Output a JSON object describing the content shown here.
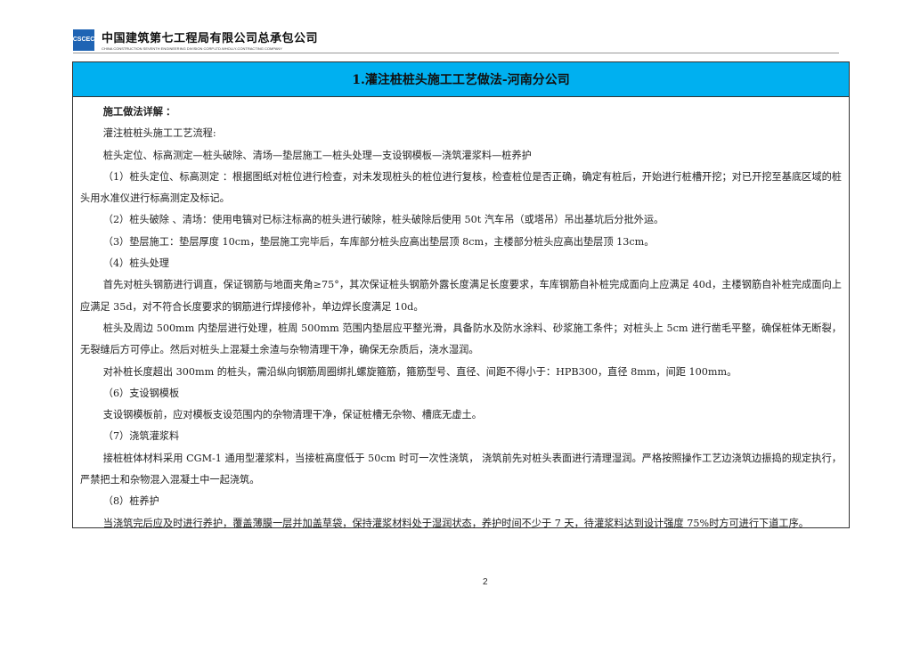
{
  "header": {
    "logo_text": "CSCEC",
    "company_cn": "中国建筑第七工程局有限公司总承包公司",
    "company_en": "CHINA CONSTRUCTION SEVENTH ENGINEERING DIVISION CORP.LTD.WHOLLY-CONTRACTING COMPANY"
  },
  "title": "1.灌注桩桩头施工工艺做法-河南分公司",
  "heading": "施工做法详解 ：",
  "paragraphs": [
    "灌注桩桩头施工工艺流程:",
    "桩头定位、标高测定—桩头破除、清场—垫层施工—桩头处理—支设钢模板—浇筑灌浆料—桩养护",
    "（1）桩头定位、标高测定 ：根据图纸对桩位进行检查，对未发现桩头的桩位进行复核，检查桩位是否正确，确定有桩后，开始进行桩槽开挖；对已开挖至基底区域的桩头用水准仪进行标高测定及标记。",
    "（2）桩头破除 、清场：使用电镐对已标注标高的桩头进行破除，桩头破除后使用 50t 汽车吊（或塔吊）吊出基坑后分批外运。",
    "（3）垫层施工：垫层厚度 10cm，垫层施工完毕后，车库部分桩头应高出垫层顶 8cm，主楼部分桩头应高出垫层顶 13cm。",
    "（4）桩头处理",
    "首先对桩头钢筋进行调直，保证钢筋与地面夹角≥75°，其次保证桩头钢筋外露长度满足长度要求，车库钢筋自补桩完成面向上应满足 40d，主楼钢筋自补桩完成面向上应满足 35d，对不符合长度要求的钢筋进行焊接修补，单边焊长度满足 10d。",
    "桩头及周边 500mm 内垫层进行处理，桩周 500mm 范围内垫层应平整光滑，具备防水及防水涂料、砂浆施工条件；对桩头上 5cm 进行凿毛平整，确保桩体无断裂，无裂缝后方可停止。然后对桩头上混凝土余渣与杂物清理干净，确保无杂质后，浇水湿润。",
    "对补桩长度超出 300mm 的桩头，需沿纵向钢筋周圈绑扎螺旋箍筋，箍筋型号、直径、间距不得小于：HPB300，直径 8mm，间距 100mm。",
    "（6）支设钢模板",
    "支设钢模板前，应对模板支设范围内的杂物清理干净，保证桩槽无杂物、槽底无虚土。",
    "（7）浇筑灌浆料",
    "接桩桩体材料采用 CGM-1 通用型灌浆料，当接桩高度低于 50cm 时可一次性浇筑， 浇筑前先对桩头表面进行清理湿润。严格按照操作工艺边浇筑边振捣的规定执行，严禁把土和杂物混入混凝土中一起浇筑。",
    "（8）桩养护",
    "当浇筑完后应及时进行养护，覆盖薄膜一层并加盖草袋，保持灌浆材料处于湿润状态，养护时间不少于 7 天，待灌浆料达到设计强度 75%时方可进行下道工序。"
  ],
  "page_number": "2"
}
